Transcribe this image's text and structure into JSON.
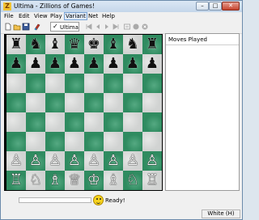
{
  "window": {
    "title": "Ultima - Zillions of Games!",
    "app_icon": "Z"
  },
  "window_controls": {
    "minimize": "–",
    "maximize": "□",
    "close": "✕"
  },
  "menu": [
    "File",
    "Edit",
    "View",
    "Play",
    "Variant",
    "Net",
    "Help"
  ],
  "menu_active": "Variant",
  "toolbar": {
    "buttons": [
      "new-icon",
      "open-icon",
      "save-icon",
      "properties-icon"
    ],
    "variant_checked": "✓",
    "variant_label": "Ultima",
    "nav_buttons": [
      "first-move-icon",
      "previous-move-icon",
      "next-move-icon",
      "last-move-icon",
      "undo-icon",
      "stop-icon",
      "cancel-icon"
    ]
  },
  "board": {
    "rows": [
      [
        "♜",
        "♞",
        "♝",
        "♛",
        "♚",
        "♝",
        "♞",
        "♜"
      ],
      [
        "♟",
        "♟",
        "♟",
        "♟",
        "♟",
        "♟",
        "♟",
        "♟"
      ],
      [
        "",
        "",
        "",
        "",
        "",
        "",
        "",
        ""
      ],
      [
        "",
        "",
        "",
        "",
        "",
        "",
        "",
        ""
      ],
      [
        "",
        "",
        "",
        "",
        "",
        "",
        "",
        ""
      ],
      [
        "",
        "",
        "",
        "",
        "",
        "",
        "",
        ""
      ],
      [
        "♙",
        "♙",
        "♙",
        "♙",
        "♙",
        "♙",
        "♙",
        "♙"
      ],
      [
        "♖",
        "♘",
        "♗",
        "♕",
        "♔",
        "♗",
        "♘",
        "♖"
      ]
    ],
    "light_color": "#d1d3d2",
    "dark_color": "#2f8b60"
  },
  "moves_panel": {
    "title": "Moves Played"
  },
  "status": {
    "text": "Ready!",
    "player": "White (H)"
  }
}
